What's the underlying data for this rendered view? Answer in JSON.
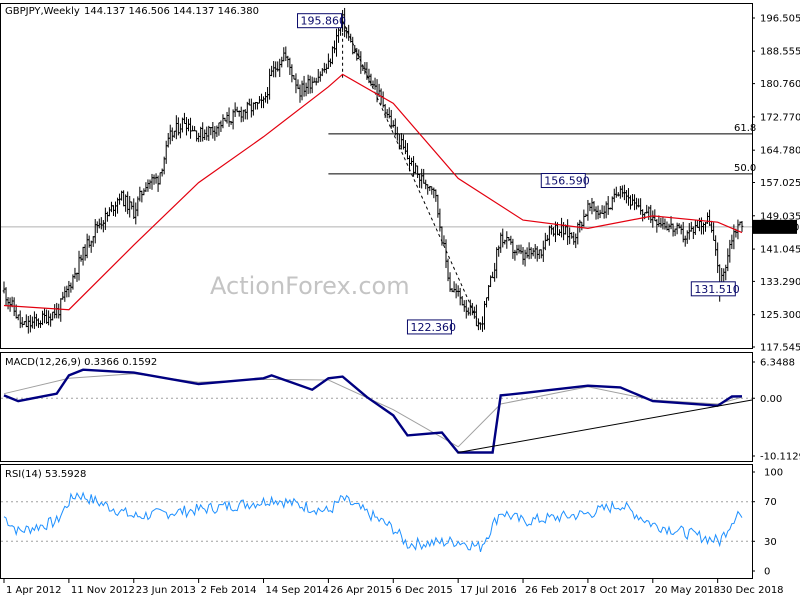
{
  "header": {
    "title": "GBPJPY,Weekly",
    "ohlc": "144.137 146.506 144.137 146.380"
  },
  "watermark": "ActionForex.com",
  "colors": {
    "price": "#000000",
    "sma": "#e3000f",
    "macd": "#000080",
    "signal": "#a0a0a0",
    "rsi": "#1e90ff",
    "fib": "#000000",
    "current_price_bg": "#000000"
  },
  "chart_data": [
    {
      "type": "candlestick",
      "title": "GBPJPY,Weekly",
      "ylim": [
        117.545,
        196.505
      ],
      "y_ticks": [
        "196.505",
        "188.555",
        "180.760",
        "172.770",
        "164.780",
        "157.025",
        "149.035",
        "141.045",
        "133.290",
        "125.300",
        "117.545"
      ],
      "current_price": "146.380",
      "x_labels": [
        "1 Apr 2012",
        "11 Nov 2012",
        "23 Jun 2013",
        "2 Feb 2014",
        "14 Sep 2014",
        "26 Apr 2015",
        "6 Dec 2015",
        "17 Jul 2016",
        "26 Feb 2017",
        "8 Oct 2017",
        "20 May 2018",
        "30 Dec 2018"
      ],
      "price_series": [
        [
          "1 Apr 2012",
          131.0
        ],
        [
          "3 Jun 2012",
          122.5
        ],
        [
          "1 Jul 2012",
          123.0
        ],
        [
          "5 Aug 2012",
          124.0
        ],
        [
          "7 Oct 2012",
          126.5
        ],
        [
          "11 Nov 2012",
          132.0
        ],
        [
          "30 Dec 2012",
          140.0
        ],
        [
          "20 Jan 2013",
          143.0
        ],
        [
          "17 Feb 2013",
          147.0
        ],
        [
          "24 Mar 2013",
          149.0
        ],
        [
          "5 May 2013",
          154.0
        ],
        [
          "23 Jun 2013",
          150.0
        ],
        [
          "4 Aug 2013",
          157.0
        ],
        [
          "15 Sep 2013",
          158.0
        ],
        [
          "27 Oct 2013",
          168.0
        ],
        [
          "15 Dec 2013",
          172.0
        ],
        [
          "2 Feb 2014",
          168.5
        ],
        [
          "23 Mar 2014",
          170.0
        ],
        [
          "11 May 2014",
          172.0
        ],
        [
          "29 Jun 2014",
          174.0
        ],
        [
          "14 Sep 2014",
          176.0
        ],
        [
          "12 Oct 2014",
          183.0
        ],
        [
          "23 Nov 2014",
          188.0
        ],
        [
          "18 Jan 2015",
          179.0
        ],
        [
          "8 Mar 2015",
          182.0
        ],
        [
          "26 Apr 2015",
          185.0
        ],
        [
          "24 May 2015",
          192.0
        ],
        [
          "14 Jun 2015",
          195.86
        ],
        [
          "19 Jul 2015",
          189.0
        ],
        [
          "23 Aug 2015",
          184.0
        ],
        [
          "27 Sep 2015",
          181.0
        ],
        [
          "8 Nov 2015",
          175.0
        ],
        [
          "6 Dec 2015",
          170.0
        ],
        [
          "24 Jan 2016",
          163.0
        ],
        [
          "6 Mar 2016",
          158.0
        ],
        [
          "24 Apr 2016",
          156.0
        ],
        [
          "19 Jun 2016",
          132.0
        ],
        [
          "17 Jul 2016",
          130.0
        ],
        [
          "2 Oct 2016",
          122.36
        ],
        [
          "6 Nov 2016",
          133.0
        ],
        [
          "11 Dec 2016",
          144.0
        ],
        [
          "22 Jan 2017",
          141.0
        ],
        [
          "26 Feb 2017",
          139.0
        ],
        [
          "30 Apr 2017",
          141.0
        ],
        [
          "28 May 2017",
          146.0
        ],
        [
          "25 Jun 2017",
          146.0
        ],
        [
          "20 Aug 2017",
          144.0
        ],
        [
          "8 Oct 2017",
          151.0
        ],
        [
          "19 Nov 2017",
          150.0
        ],
        [
          "31 Dec 2017",
          152.0
        ],
        [
          "28 Jan 2018",
          156.59
        ],
        [
          "18 Mar 2018",
          151.0
        ],
        [
          "20 May 2018",
          149.0
        ],
        [
          "29 Jul 2018",
          146.0
        ],
        [
          "9 Sep 2018",
          144.0
        ],
        [
          "21 Oct 2018",
          147.0
        ],
        [
          "2 Dec 2018",
          148.0
        ],
        [
          "30 Dec 2018",
          137.0
        ],
        [
          "6 Jan 2019",
          131.51
        ],
        [
          "17 Feb 2019",
          144.0
        ],
        [
          "10 Mar 2019",
          147.0
        ],
        [
          "24 Mar 2019",
          146.38
        ]
      ],
      "sma_series": [
        [
          "1 Apr 2012",
          127.5
        ],
        [
          "11 Nov 2012",
          126.5
        ],
        [
          "23 Jun 2013",
          142.0
        ],
        [
          "2 Feb 2014",
          157.0
        ],
        [
          "14 Sep 2014",
          168.0
        ],
        [
          "26 Apr 2015",
          180.0
        ],
        [
          "14 Jun 2015",
          183.0
        ],
        [
          "6 Dec 2015",
          176.0
        ],
        [
          "17 Jul 2016",
          158.0
        ],
        [
          "26 Feb 2017",
          148.0
        ],
        [
          "8 Oct 2017",
          146.0
        ],
        [
          "20 May 2018",
          149.0
        ],
        [
          "30 Dec 2018",
          147.5
        ],
        [
          "24 Mar 2019",
          145.0
        ]
      ],
      "fib_levels": [
        {
          "label": "61.8",
          "value": 168.7
        },
        {
          "label": "50.0",
          "value": 159.1
        }
      ],
      "annotations": [
        "195.860",
        "156.590",
        "131.510",
        "122.360"
      ]
    },
    {
      "type": "line",
      "title": "MACD(12,26,9) 0.3366 0.1592",
      "ylim": [
        -10.1129,
        6.3488
      ],
      "y_ticks": [
        "6.3488",
        "0.00",
        "-10.1129"
      ],
      "macd_series": [
        [
          "1 Apr 2012",
          0.5
        ],
        [
          "20 May 2012",
          -0.5
        ],
        [
          "30 Sep 2012",
          0.8
        ],
        [
          "11 Nov 2012",
          4.0
        ],
        [
          "30 Dec 2012",
          5.0
        ],
        [
          "23 Jun 2013",
          4.5
        ],
        [
          "2 Feb 2014",
          2.5
        ],
        [
          "14 Sep 2014",
          3.5
        ],
        [
          "12 Oct 2014",
          4.0
        ],
        [
          "1 Mar 2015",
          1.5
        ],
        [
          "26 Apr 2015",
          3.5
        ],
        [
          "14 Jun 2015",
          3.8
        ],
        [
          "6 Sep 2015",
          0.2
        ],
        [
          "6 Dec 2015",
          -3.0
        ],
        [
          "24 Jan 2016",
          -6.5
        ],
        [
          "22 May 2016",
          -6.0
        ],
        [
          "17 Jul 2016",
          -9.5
        ],
        [
          "13 Nov 2016",
          -9.5
        ],
        [
          "11 Dec 2016",
          0.5
        ],
        [
          "26 Feb 2017",
          0.9
        ],
        [
          "8 Oct 2017",
          2.2
        ],
        [
          "28 Jan 2018",
          1.9
        ],
        [
          "20 May 2018",
          -0.5
        ],
        [
          "30 Dec 2018",
          -1.3
        ],
        [
          "17 Feb 2019",
          0.3
        ],
        [
          "24 Mar 2019",
          0.3366
        ]
      ],
      "signal_series": [
        [
          "1 Apr 2012",
          0.8
        ],
        [
          "11 Nov 2012",
          3.5
        ],
        [
          "23 Jun 2013",
          4.3
        ],
        [
          "2 Feb 2014",
          2.8
        ],
        [
          "14 Sep 2014",
          3.3
        ],
        [
          "26 Apr 2015",
          3.2
        ],
        [
          "6 Dec 2015",
          -2.0
        ],
        [
          "17 Jul 2016",
          -8.5
        ],
        [
          "11 Dec 2016",
          -1.0
        ],
        [
          "8 Oct 2017",
          2.0
        ],
        [
          "20 May 2018",
          -0.3
        ],
        [
          "30 Dec 2018",
          -1.0
        ],
        [
          "24 Mar 2019",
          0.1592
        ]
      ],
      "trendline": [
        [
          "17 Jul 2016",
          -9.5
        ],
        [
          "24 Mar 2019",
          -0.3
        ]
      ]
    },
    {
      "type": "line",
      "title": "RSI(14) 53.5928",
      "ylim": [
        0,
        100
      ],
      "y_ticks": [
        "100",
        "70",
        "30",
        "0"
      ],
      "levels": [
        70,
        30
      ],
      "series": [
        [
          "1 Apr 2012",
          55
        ],
        [
          "20 May 2012",
          40
        ],
        [
          "30 Sep 2012",
          50
        ],
        [
          "11 Nov 2012",
          70
        ],
        [
          "9 Dec 2012",
          78
        ],
        [
          "23 Jun 2013",
          55
        ],
        [
          "2 Feb 2014",
          62
        ],
        [
          "14 Sep 2014",
          70
        ],
        [
          "12 Oct 2014",
          73
        ],
        [
          "26 Apr 2015",
          60
        ],
        [
          "14 Jun 2015",
          73
        ],
        [
          "6 Dec 2015",
          43
        ],
        [
          "24 Jan 2016",
          27
        ],
        [
          "17 Jul 2016",
          30
        ],
        [
          "2 Oct 2016",
          24
        ],
        [
          "11 Dec 2016",
          60
        ],
        [
          "26 Feb 2017",
          50
        ],
        [
          "8 Oct 2017",
          58
        ],
        [
          "28 Jan 2018",
          67
        ],
        [
          "20 May 2018",
          47
        ],
        [
          "6 Jan 2019",
          30
        ],
        [
          "17 Feb 2019",
          50
        ],
        [
          "10 Mar 2019",
          60
        ],
        [
          "24 Mar 2019",
          53.5928
        ]
      ]
    }
  ]
}
